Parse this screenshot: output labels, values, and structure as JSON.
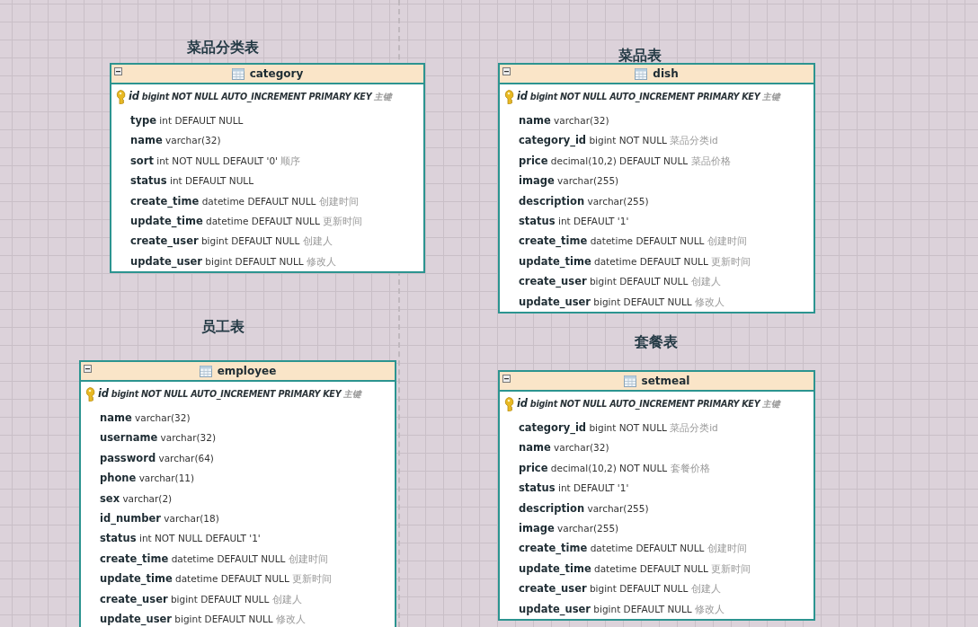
{
  "tables": [
    {
      "caption": "菜品分类表",
      "name": "category",
      "collapsed": false,
      "columns": [
        {
          "kind": "primary",
          "name": "id",
          "type": "bigint NOT NULL AUTO_INCREMENT PRIMARY KEY",
          "comment": "主键"
        },
        {
          "kind": "field",
          "name": "type",
          "type": "int DEFAULT NULL"
        },
        {
          "kind": "field",
          "name": "name",
          "type": "varchar(32)"
        },
        {
          "kind": "field",
          "name": "sort",
          "type": "int NOT NULL DEFAULT '0'",
          "comment": "顺序"
        },
        {
          "kind": "field",
          "name": "status",
          "type": "int DEFAULT NULL"
        },
        {
          "kind": "field",
          "name": "create_time",
          "type": "datetime DEFAULT NULL",
          "comment": "创建时间"
        },
        {
          "kind": "field",
          "name": "update_time",
          "type": "datetime DEFAULT NULL",
          "comment": "更新时间"
        },
        {
          "kind": "field",
          "name": "create_user",
          "type": "bigint DEFAULT NULL",
          "comment": "创建人"
        },
        {
          "kind": "field",
          "name": "update_user",
          "type": "bigint DEFAULT NULL",
          "comment": "修改人"
        }
      ]
    },
    {
      "caption": "菜品表",
      "name": "dish",
      "collapsed": false,
      "columns": [
        {
          "kind": "primary",
          "name": "id",
          "type": "bigint NOT NULL AUTO_INCREMENT PRIMARY KEY",
          "comment": "主键"
        },
        {
          "kind": "field",
          "name": "name",
          "type": "varchar(32)"
        },
        {
          "kind": "field",
          "name": "category_id",
          "type": "bigint NOT NULL",
          "comment": "菜品分类id"
        },
        {
          "kind": "field",
          "name": "price",
          "type": "decimal(10,2) DEFAULT NULL",
          "comment": "菜品价格"
        },
        {
          "kind": "field",
          "name": "image",
          "type": "varchar(255)"
        },
        {
          "kind": "field",
          "name": "description",
          "type": "varchar(255)"
        },
        {
          "kind": "field",
          "name": "status",
          "type": "int DEFAULT '1'"
        },
        {
          "kind": "field",
          "name": "create_time",
          "type": "datetime DEFAULT NULL",
          "comment": "创建时间"
        },
        {
          "kind": "field",
          "name": "update_time",
          "type": "datetime DEFAULT NULL",
          "comment": "更新时间"
        },
        {
          "kind": "field",
          "name": "create_user",
          "type": "bigint DEFAULT NULL",
          "comment": "创建人"
        },
        {
          "kind": "field",
          "name": "update_user",
          "type": "bigint DEFAULT NULL",
          "comment": "修改人"
        }
      ]
    },
    {
      "caption": "员工表",
      "name": "employee",
      "collapsed": false,
      "columns": [
        {
          "kind": "primary",
          "name": "id",
          "type": "bigint NOT NULL AUTO_INCREMENT PRIMARY KEY",
          "comment": "主键"
        },
        {
          "kind": "field",
          "name": "name",
          "type": "varchar(32)"
        },
        {
          "kind": "field",
          "name": "username",
          "type": "varchar(32)"
        },
        {
          "kind": "field",
          "name": "password",
          "type": "varchar(64)"
        },
        {
          "kind": "field",
          "name": "phone",
          "type": "varchar(11)"
        },
        {
          "kind": "field",
          "name": "sex",
          "type": "varchar(2)"
        },
        {
          "kind": "field",
          "name": "id_number",
          "type": "varchar(18)"
        },
        {
          "kind": "field",
          "name": "status",
          "type": "int NOT NULL DEFAULT '1'"
        },
        {
          "kind": "field",
          "name": "create_time",
          "type": "datetime DEFAULT NULL",
          "comment": "创建时间"
        },
        {
          "kind": "field",
          "name": "update_time",
          "type": "datetime DEFAULT NULL",
          "comment": "更新时间"
        },
        {
          "kind": "field",
          "name": "create_user",
          "type": "bigint DEFAULT NULL",
          "comment": "创建人"
        },
        {
          "kind": "field",
          "name": "update_user",
          "type": "bigint DEFAULT NULL",
          "comment": "修改人"
        }
      ]
    },
    {
      "caption": "套餐表",
      "name": "setmeal",
      "collapsed": false,
      "columns": [
        {
          "kind": "primary",
          "name": "id",
          "type": "bigint NOT NULL AUTO_INCREMENT PRIMARY KEY",
          "comment": "主键"
        },
        {
          "kind": "field",
          "name": "category_id",
          "type": "bigint NOT NULL",
          "comment": "菜品分类id"
        },
        {
          "kind": "field",
          "name": "name",
          "type": "varchar(32)"
        },
        {
          "kind": "field",
          "name": "price",
          "type": "decimal(10,2) NOT NULL",
          "comment": "套餐价格"
        },
        {
          "kind": "field",
          "name": "status",
          "type": "int DEFAULT '1'"
        },
        {
          "kind": "field",
          "name": "description",
          "type": "varchar(255)"
        },
        {
          "kind": "field",
          "name": "image",
          "type": "varchar(255)"
        },
        {
          "kind": "field",
          "name": "create_time",
          "type": "datetime DEFAULT NULL",
          "comment": "创建时间"
        },
        {
          "kind": "field",
          "name": "update_time",
          "type": "datetime DEFAULT NULL",
          "comment": "更新时间"
        },
        {
          "kind": "field",
          "name": "create_user",
          "type": "bigint DEFAULT NULL",
          "comment": "创建人"
        },
        {
          "kind": "field",
          "name": "update_user",
          "type": "bigint DEFAULT NULL",
          "comment": "修改人"
        }
      ]
    }
  ]
}
